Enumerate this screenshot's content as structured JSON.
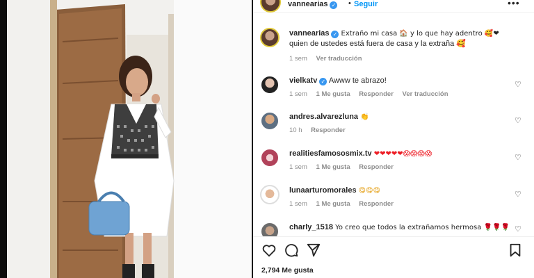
{
  "post": {
    "username": "vannearias",
    "separator": "•",
    "follow_label": "Seguir",
    "more_label": "•••"
  },
  "caption": {
    "username": "vannearias",
    "text_line1": "Extraño mi casa 🏠 y lo que hay adentro 🥰❤",
    "text_line2": "quien de ustedes está fuera de casa y la extraña 🥰",
    "time": "1 sem",
    "translate": "Ver traducción"
  },
  "comments": [
    {
      "username": "vielkatv",
      "verified": true,
      "text": "Awww te abrazo!",
      "time": "1 sem",
      "likes": "1 Me gusta",
      "reply": "Responder",
      "translate": "Ver traducción"
    },
    {
      "username": "andres.alvarezluna",
      "verified": false,
      "text": "👏",
      "time": "10 h",
      "likes": "",
      "reply": "Responder",
      "translate": ""
    },
    {
      "username": "realitiesfamososmix.tv",
      "verified": false,
      "text": "❤❤❤❤❤😱😱😱😱",
      "time": "1 sem",
      "likes": "1 Me gusta",
      "reply": "Responder",
      "translate": ""
    },
    {
      "username": "lunaarturomorales",
      "verified": false,
      "text": "😋😋😋",
      "time": "1 sem",
      "likes": "1 Me gusta",
      "reply": "Responder",
      "translate": ""
    },
    {
      "username": "charly_1518",
      "verified": false,
      "text": "Yo creo que todos la extrañamos hermosa 🌹🌹🌹",
      "time": "",
      "likes": "",
      "reply": "",
      "translate": ""
    }
  ],
  "footer": {
    "likes_count": "2,794 Me gusta"
  },
  "icons": [
    "like-icon",
    "comment-icon",
    "share-icon",
    "save-icon",
    "heart-small-icon",
    "more-icon",
    "verified-icon"
  ],
  "colors": {
    "accent": "#0095f6",
    "verified": "#3897f0",
    "meta": "#8e8e8e",
    "text": "#262626"
  }
}
